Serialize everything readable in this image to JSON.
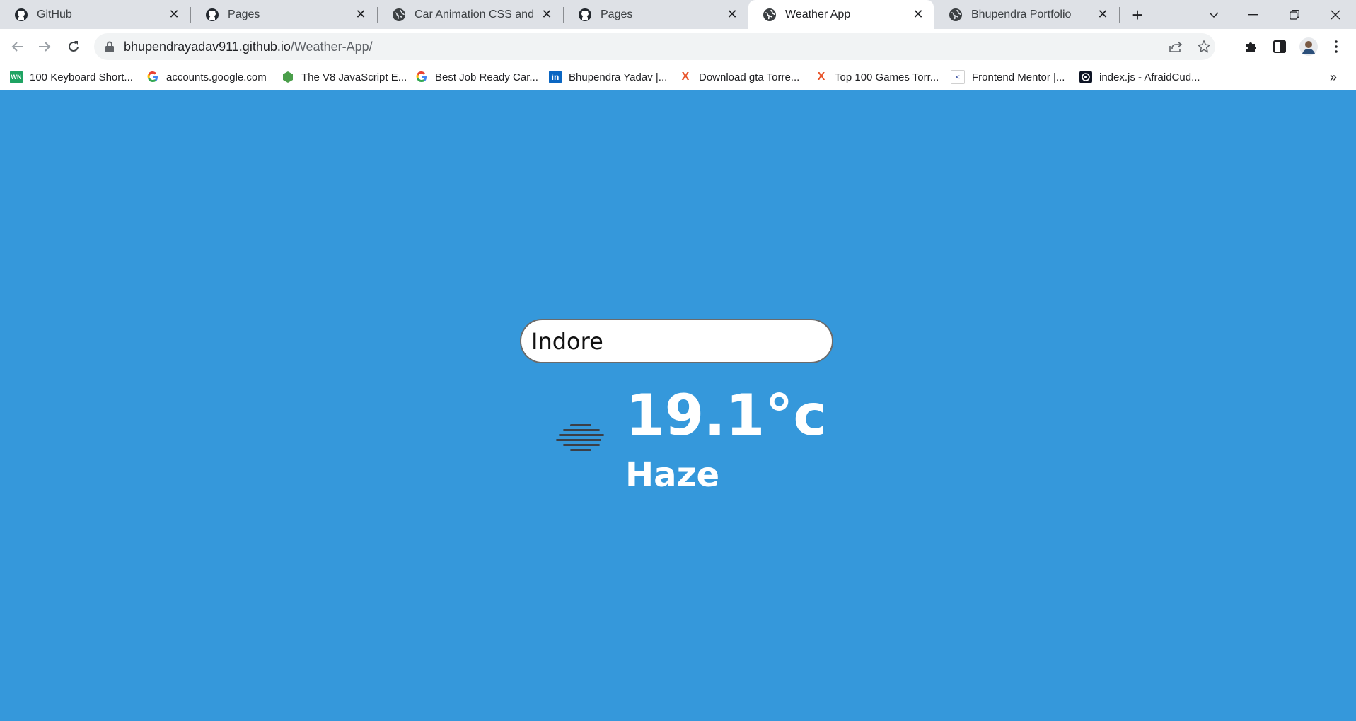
{
  "browser": {
    "tabs": [
      {
        "title": "GitHub",
        "icon": "github-icon"
      },
      {
        "title": "Pages",
        "icon": "github-icon"
      },
      {
        "title": "Car Animation CSS and JavaScript",
        "icon": "globe-icon"
      },
      {
        "title": "Pages",
        "icon": "github-icon"
      },
      {
        "title": "Weather App",
        "icon": "globe-icon",
        "active": true
      },
      {
        "title": "Bhupendra Portfolio",
        "icon": "globe-icon"
      }
    ],
    "close_glyph": "✕",
    "new_tab_glyph": "+",
    "url_host": "bhupendrayadav911.github.io",
    "url_path": "/Weather-App/",
    "bookmarks": [
      {
        "label": "100 Keyboard Short...",
        "icon": "wn-icon"
      },
      {
        "label": "accounts.google.com",
        "icon": "google-icon"
      },
      {
        "label": "The V8 JavaScript E...",
        "icon": "v8-icon"
      },
      {
        "label": "Best Job Ready Car...",
        "icon": "google-icon"
      },
      {
        "label": "Bhupendra Yadav |...",
        "icon": "linkedin-icon"
      },
      {
        "label": "Download gta Torre...",
        "icon": "x-torrent-icon"
      },
      {
        "label": "Top 100 Games Torr...",
        "icon": "x-torrent-icon"
      },
      {
        "label": "Frontend Mentor |...",
        "icon": "frontend-mentor-icon"
      },
      {
        "label": "index.js - AfraidCud...",
        "icon": "replit-icon"
      }
    ],
    "bookmarks_overflow": "»"
  },
  "app": {
    "background_color": "#3598db",
    "search_value": "Indore",
    "temperature": "19.1°c",
    "description": "Haze",
    "weather_icon": "haze-icon"
  }
}
